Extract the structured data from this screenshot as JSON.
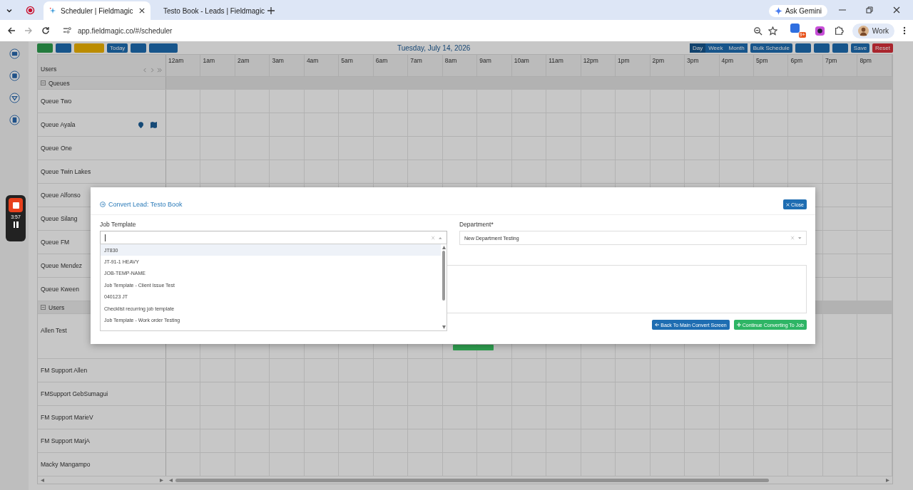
{
  "browser": {
    "tabs": [
      {
        "title": "Scheduler | Fieldmagic",
        "selected": true
      },
      {
        "title": "Testo Book - Leads | Fieldmagic",
        "selected": false
      }
    ],
    "url": "app.fieldmagic.co/#/scheduler",
    "gemini": "Ask Gemini",
    "extension_badge": "9+",
    "profile": "Work"
  },
  "toolbar": {
    "today": "Today",
    "date": "Tuesday, July 14, 2026",
    "views": [
      {
        "label": "Day",
        "selected": true
      },
      {
        "label": "Week",
        "selected": false
      },
      {
        "label": "Month",
        "selected": false
      }
    ],
    "bulk": "Bulk Schedule",
    "save": "Save",
    "reset": "Reset"
  },
  "scheduler": {
    "users_heading": "Users",
    "hours": [
      "12am",
      "1am",
      "2am",
      "3am",
      "4am",
      "5am",
      "6am",
      "7am",
      "8am",
      "9am",
      "10am",
      "11am",
      "12pm",
      "1pm",
      "2pm",
      "3pm",
      "4pm",
      "5pm",
      "6pm",
      "7pm",
      "8pm"
    ],
    "sections": [
      {
        "label": "Queues",
        "expanded": true,
        "rows": [
          {
            "name": "Queue Two",
            "has_location": false
          },
          {
            "name": "Queue Ayala",
            "has_location": true
          },
          {
            "name": "Queue One",
            "has_location": false
          },
          {
            "name": "Queue Twin Lakes",
            "has_location": false
          },
          {
            "name": "Queue Alfonso",
            "has_location": false
          },
          {
            "name": "Queue Silang",
            "has_location": false
          },
          {
            "name": "Queue FM",
            "has_location": false
          },
          {
            "name": "Queue Mendez",
            "has_location": false
          },
          {
            "name": "Queue Kween",
            "has_location": false
          }
        ]
      },
      {
        "label": "Users",
        "expanded": true,
        "rows": [
          {
            "name": "Allen Test",
            "has_location": false,
            "events": [
              {
                "color": "#2e9e4f"
              }
            ]
          },
          {
            "name": "FM Support Allen",
            "has_location": false
          },
          {
            "name": "FMSupport GebSumagui",
            "has_location": false
          },
          {
            "name": "FM Support MarieV",
            "has_location": false
          },
          {
            "name": "FM Support MarjA",
            "has_location": false
          },
          {
            "name": "Macky Mangampo",
            "has_location": false
          }
        ]
      }
    ]
  },
  "recorder": {
    "time": "3:57"
  },
  "modal": {
    "title": "Convert Lead: Testo Book",
    "close": "Close",
    "job_template": {
      "label": "Job Template",
      "expanded": true,
      "options": [
        {
          "label": "JT830",
          "selected": true
        },
        {
          "label": "JT-91-1 HEAVY",
          "selected": false
        },
        {
          "label": "JOB-TEMP-NAME",
          "selected": false
        },
        {
          "label": "Job Template - Client Issue Test",
          "selected": false
        },
        {
          "label": "040123 JT",
          "selected": false
        },
        {
          "label": "Checklist recurring job template",
          "selected": false
        },
        {
          "label": "Job Template - Work order Testing",
          "selected": false
        }
      ]
    },
    "department": {
      "label": "Department*",
      "value": "New Department Testing"
    },
    "back": "Back To Main Convert Screen",
    "continue": "Continue Converting To Job"
  }
}
